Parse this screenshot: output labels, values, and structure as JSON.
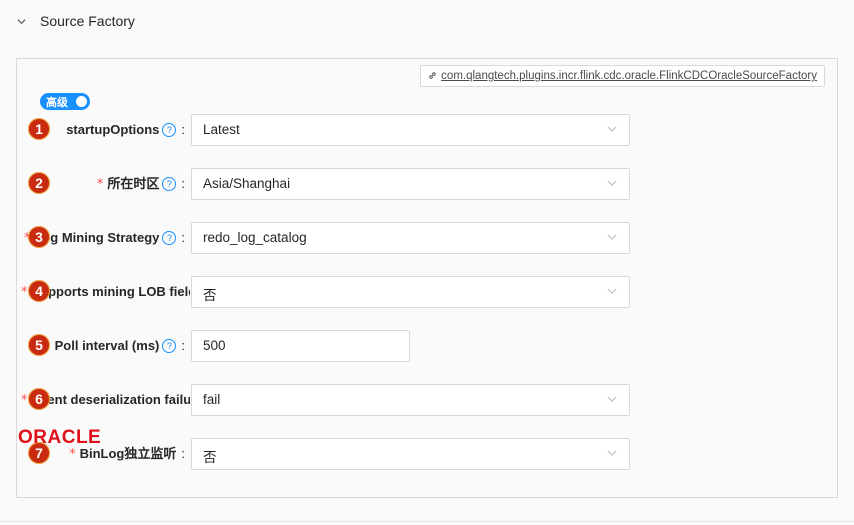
{
  "section": {
    "title": "Source Factory"
  },
  "panel": {
    "class_link": "com.qlangtech.plugins.incr.flink.cdc.oracle.FlinkCDCOracleSourceFactory",
    "advanced_toggle": {
      "label": "高级",
      "on": true
    }
  },
  "fields": [
    {
      "badge": "1",
      "label": "startupOptions",
      "required": false,
      "help": true,
      "type": "select",
      "value": "Latest"
    },
    {
      "badge": "2",
      "label": "所在时区",
      "required": true,
      "help": true,
      "type": "select",
      "value": "Asia/Shanghai"
    },
    {
      "badge": "3",
      "label": "Log Mining Strategy",
      "required": true,
      "help": true,
      "type": "select",
      "value": "redo_log_catalog"
    },
    {
      "badge": "4",
      "label": "Supports mining LOB fields",
      "required": true,
      "help": false,
      "type": "select",
      "value": "否"
    },
    {
      "badge": "5",
      "label": "Poll interval (ms)",
      "required": false,
      "help": true,
      "type": "input",
      "value": "500"
    },
    {
      "badge": "6",
      "label": "Event deserialization failure handling",
      "required": true,
      "help": false,
      "type": "select",
      "value": "fail"
    },
    {
      "badge": "7",
      "label": "BinLog独立监听",
      "required": true,
      "help": false,
      "type": "select",
      "value": "否"
    }
  ],
  "required_mark": "*",
  "help_glyph": "?",
  "colon": ":",
  "logo": {
    "text": "ORACLE",
    "color": "#e0101a"
  },
  "colors": {
    "accent": "#1890ff",
    "badge": "#c82b10",
    "required": "#ff4d4f"
  }
}
